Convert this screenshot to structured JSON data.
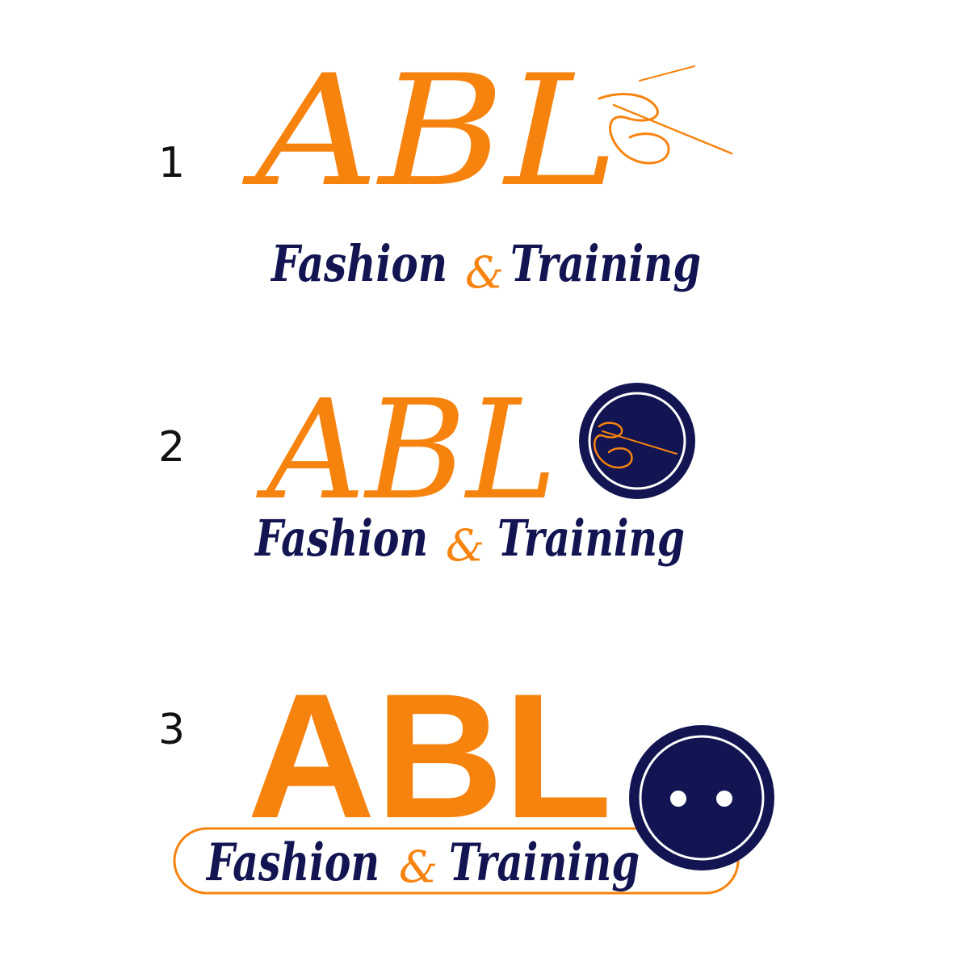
{
  "colors": {
    "accent": "#F7830F",
    "navy": "#121551",
    "white": "#ffffff"
  },
  "options": [
    {
      "number": "1",
      "monogram": "ABL",
      "tagline": {
        "left": "Fashion",
        "amp": "&",
        "right": "Training"
      }
    },
    {
      "number": "2",
      "monogram": "ABL",
      "tagline": {
        "left": "Fashion",
        "amp": "&",
        "right": "Training"
      }
    },
    {
      "number": "3",
      "monogram": "ABL",
      "tagline": {
        "left": "Fashion",
        "amp": "&",
        "right": "Training"
      }
    }
  ]
}
